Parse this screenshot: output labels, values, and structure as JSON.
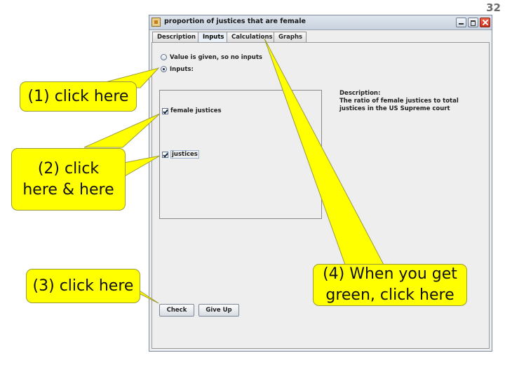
{
  "slide_number": "32",
  "window": {
    "title": "proportion of justices that are female",
    "tabs": [
      "Description",
      "Inputs",
      "Calculations",
      "Graphs"
    ],
    "active_tab": "Inputs"
  },
  "options": {
    "value_given_label": "Value is given, so no inputs",
    "inputs_label": "Inputs:",
    "selected": "Inputs:"
  },
  "inputs": [
    {
      "label": "female justices",
      "checked": true
    },
    {
      "label": "justices",
      "checked": true
    }
  ],
  "description": {
    "heading": "Description:",
    "text": "The ratio of female justices to total justices in the US Supreme court"
  },
  "buttons": {
    "check": "Check",
    "give_up": "Give Up"
  },
  "callouts": {
    "c1": "(1) click here",
    "c2_line1": "(2) click",
    "c2_line2": "here & here",
    "c3": "(3) click here",
    "c4_line1": "(4) When you get",
    "c4_line2": "green, click here"
  },
  "colors": {
    "callout_fill": "#ffff00",
    "window_bg": "#eeeeee"
  }
}
